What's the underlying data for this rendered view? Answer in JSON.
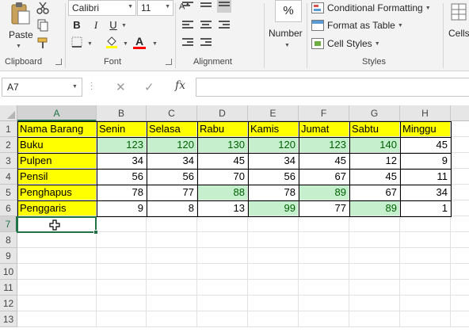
{
  "ribbon": {
    "clipboard": {
      "label": "Clipboard",
      "paste_label": "Paste"
    },
    "font": {
      "label": "Font",
      "name": "Calibri",
      "size": "11"
    },
    "alignment": {
      "label": "Alignment"
    },
    "number": {
      "label": "Number",
      "format_symbol": "%"
    },
    "styles": {
      "label": "Styles",
      "conditional_formatting": "Conditional Formatting",
      "format_as_table": "Format as Table",
      "cell_styles": "Cell Styles"
    },
    "cells": {
      "label": "Cells"
    }
  },
  "formula_bar": {
    "name_box": "A7",
    "fx": "fx",
    "cancel_symbol": "✕",
    "enter_symbol": "✓",
    "formula": ""
  },
  "sheet": {
    "columns": [
      "A",
      "B",
      "C",
      "D",
      "E",
      "F",
      "G",
      "H"
    ],
    "rows": [
      "1",
      "2",
      "3",
      "4",
      "5",
      "6",
      "7",
      "8",
      "9",
      "10",
      "11",
      "12",
      "13"
    ],
    "active_cell": "A7",
    "header_row": [
      "Nama Barang",
      "Senin",
      "Selasa",
      "Rabu",
      "Kamis",
      "Jumat",
      "Sabtu",
      "Minggu"
    ],
    "data": [
      {
        "name": "Buku",
        "values": [
          "123",
          "120",
          "130",
          "120",
          "123",
          "140",
          "45"
        ]
      },
      {
        "name": "Pulpen",
        "values": [
          "34",
          "34",
          "45",
          "34",
          "45",
          "12",
          "9"
        ]
      },
      {
        "name": "Pensil",
        "values": [
          "56",
          "56",
          "70",
          "56",
          "67",
          "45",
          "11"
        ]
      },
      {
        "name": "Penghapus",
        "values": [
          "78",
          "77",
          "88",
          "78",
          "89",
          "67",
          "34"
        ]
      },
      {
        "name": "Penggaris",
        "values": [
          "9",
          "8",
          "13",
          "99",
          "77",
          "89",
          "1"
        ]
      }
    ],
    "highlighted": [
      [
        true,
        true,
        true,
        true,
        true,
        true,
        false
      ],
      [
        false,
        false,
        false,
        false,
        false,
        false,
        false
      ],
      [
        false,
        false,
        false,
        false,
        false,
        false,
        false
      ],
      [
        false,
        false,
        true,
        false,
        true,
        false,
        false
      ],
      [
        false,
        false,
        false,
        true,
        false,
        true,
        false
      ]
    ],
    "colors": {
      "header_fill": "#ffff00",
      "highlight_fill": "#c6efce",
      "highlight_text": "#006100",
      "selection": "#217346"
    }
  }
}
